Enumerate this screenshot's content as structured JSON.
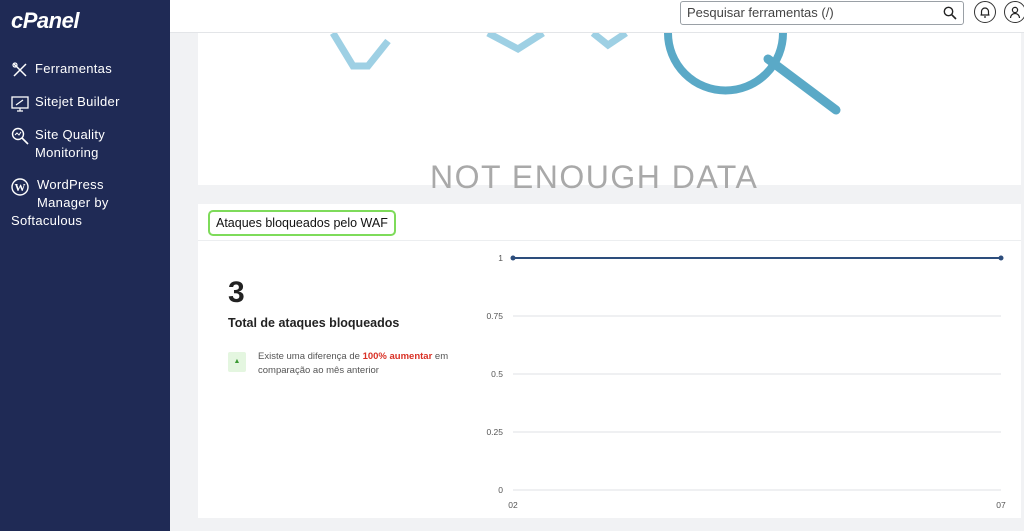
{
  "sidebar": {
    "logo": "cPanel",
    "items": [
      {
        "label": "Ferramentas",
        "icon": "tools-icon"
      },
      {
        "label": "Sitejet Builder",
        "icon": "monitor-builder-icon"
      },
      {
        "label_line1": "Site Quality",
        "label_line2": "Monitoring",
        "icon": "magnifier-quality-icon"
      },
      {
        "label_line1": "WordPress",
        "label_line2": "Manager by",
        "label_line3": "Softaculous",
        "icon": "wordpress-icon"
      }
    ]
  },
  "header": {
    "search_placeholder": "Pesquisar ferramentas (/)",
    "search_icon": "search-icon",
    "notifications_icon": "bell-icon",
    "user_icon": "user-icon"
  },
  "empty_state": {
    "text": "NOT ENOUGH DATA"
  },
  "waf_card": {
    "title": "Ataques bloqueados pelo WAF",
    "total": "3",
    "total_caption": "Total de ataques bloqueados",
    "diff_prefix": "Existe uma diferença de ",
    "diff_highlight": "100% aumentar",
    "diff_suffix": " em comparação ao mês anterior",
    "colors": {
      "line": "#2d4d7c",
      "highlight": "#d93025",
      "badge_bg": "#e4f6e0",
      "title_border": "#7edb5a"
    }
  },
  "chart_data": {
    "type": "line",
    "x": [
      "02",
      "07"
    ],
    "series": [
      {
        "values": [
          1,
          1
        ]
      }
    ],
    "yticks": [
      "0",
      "0.25",
      "0.5",
      "0.75",
      "1"
    ],
    "ylim": [
      0,
      1
    ],
    "grid": true
  }
}
